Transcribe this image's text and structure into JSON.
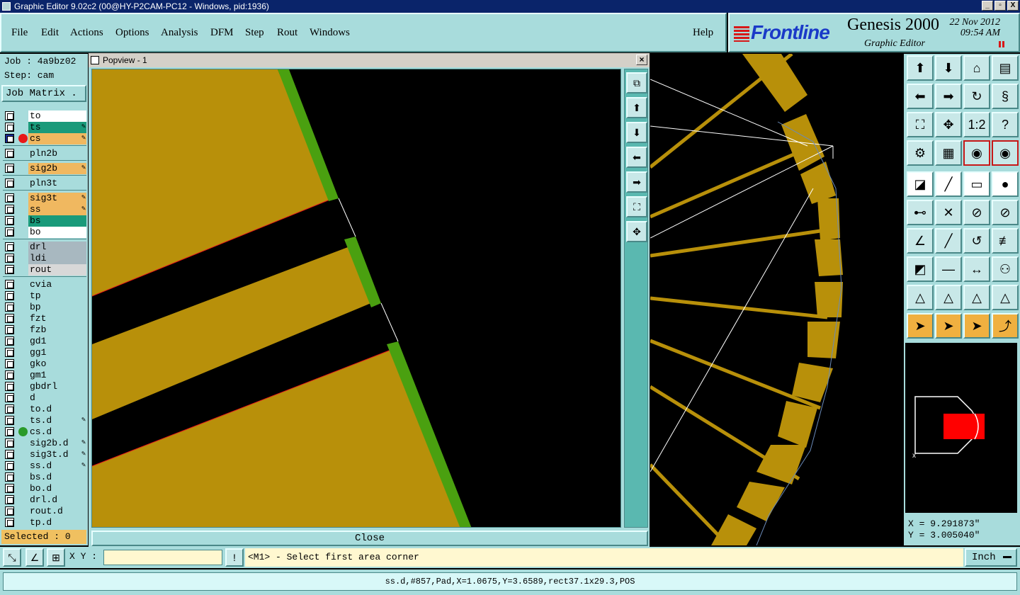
{
  "window": {
    "title": "Graphic Editor 9.02c2 (00@HY-P2CAM-PC12 - Windows, pid:1936)",
    "controls": [
      "_",
      "▫",
      "X"
    ]
  },
  "menu": {
    "items": [
      "File",
      "Edit",
      "Actions",
      "Options",
      "Analysis",
      "DFM",
      "Step",
      "Rout",
      "Windows"
    ],
    "help": "Help"
  },
  "brand": {
    "logo": "Frontline",
    "product": "Genesis 2000",
    "subtitle": "Graphic Editor",
    "date": "22 Nov 2012",
    "time": "09:54 AM"
  },
  "job": {
    "job_line": "Job : 4a9bz02",
    "step_line": "Step: cam",
    "matrix_button": "Job Matrix ."
  },
  "layers": [
    {
      "name": "to",
      "color": "#ffffff",
      "group": 0
    },
    {
      "name": "ts",
      "color": "#1a9a7a",
      "group": 0,
      "edit": true
    },
    {
      "name": "cs",
      "color": "#f0b860",
      "group": 0,
      "edit": true,
      "selected": true,
      "dot": "#e81818"
    },
    {
      "name": "pln2b",
      "color": "#a8dcdc",
      "group": 1
    },
    {
      "name": "sig2b",
      "color": "#f0b860",
      "group": 2,
      "edit": true
    },
    {
      "name": "pln3t",
      "color": "#a8dcdc",
      "group": 3
    },
    {
      "name": "sig3t",
      "color": "#f0b860",
      "group": 4,
      "edit": true
    },
    {
      "name": "ss",
      "color": "#f0b860",
      "group": 4,
      "edit": true
    },
    {
      "name": "bs",
      "color": "#1a9a7a",
      "group": 4
    },
    {
      "name": "bo",
      "color": "#ffffff",
      "group": 4
    },
    {
      "name": "drl",
      "color": "#a8b8c0",
      "group": 5
    },
    {
      "name": "ldi",
      "color": "#a8b8c0",
      "group": 5
    },
    {
      "name": "rout",
      "color": "#d8d8d8",
      "group": 5
    },
    {
      "name": "cvia",
      "color": "#a8dcdc",
      "group": 6
    },
    {
      "name": "tp",
      "color": "#a8dcdc",
      "group": 6
    },
    {
      "name": "bp",
      "color": "#a8dcdc",
      "group": 6
    },
    {
      "name": "fzt",
      "color": "#a8dcdc",
      "group": 6
    },
    {
      "name": "fzb",
      "color": "#a8dcdc",
      "group": 6
    },
    {
      "name": "gd1",
      "color": "#a8dcdc",
      "group": 6
    },
    {
      "name": "gg1",
      "color": "#a8dcdc",
      "group": 6
    },
    {
      "name": "gko",
      "color": "#a8dcdc",
      "group": 6
    },
    {
      "name": "gm1",
      "color": "#a8dcdc",
      "group": 6
    },
    {
      "name": "gbdrl",
      "color": "#a8dcdc",
      "group": 6
    },
    {
      "name": "d",
      "color": "#a8dcdc",
      "group": 6
    },
    {
      "name": "to.d",
      "color": "#a8dcdc",
      "group": 6
    },
    {
      "name": "ts.d",
      "color": "#a8dcdc",
      "group": 6,
      "edit": true
    },
    {
      "name": "cs.d",
      "color": "#a8dcdc",
      "group": 6,
      "dot": "#2a9a2a"
    },
    {
      "name": "sig2b.d",
      "color": "#a8dcdc",
      "group": 6,
      "edit": true
    },
    {
      "name": "sig3t.d",
      "color": "#a8dcdc",
      "group": 6,
      "edit": true
    },
    {
      "name": "ss.d",
      "color": "#a8dcdc",
      "group": 6,
      "edit": true
    },
    {
      "name": "bs.d",
      "color": "#a8dcdc",
      "group": 6
    },
    {
      "name": "bo.d",
      "color": "#a8dcdc",
      "group": 6
    },
    {
      "name": "drl.d",
      "color": "#a8dcdc",
      "group": 6
    },
    {
      "name": "rout.d",
      "color": "#a8dcdc",
      "group": 6
    },
    {
      "name": "tp.d",
      "color": "#a8dcdc",
      "group": 6
    }
  ],
  "selected_label": "Selected : 0",
  "popview": {
    "title": "Popview - 1",
    "close_label": "Close",
    "tools": [
      "zoom-window-icon",
      "pan-up-icon",
      "pan-down-icon",
      "pan-left-icon",
      "pan-right-icon",
      "zoom-fit-icon",
      "zoom-center-icon"
    ]
  },
  "toolbar": {
    "rows": [
      [
        "pan-up-icon",
        "pan-down-icon",
        "home-icon",
        "window-split-icon"
      ],
      [
        "pan-left-icon",
        "pan-right-icon",
        "redo-icon",
        "snap-icon"
      ],
      [
        "zoom-fit-icon",
        "zoom-center-icon",
        "scale-icon",
        "help-icon"
      ],
      [
        "settings-icon",
        "grid-icon",
        "layers-red-icon",
        "layers-red2-icon"
      ],
      [
        "select-pad-icon",
        "line-icon",
        "ruler-icon",
        "dot-icon"
      ],
      [
        "connect-icon",
        "intersect-icon",
        "add-pad-icon",
        "add-pad2-icon"
      ],
      [
        "angle-icon",
        "line-red-icon",
        "arc-icon",
        "align-icon"
      ],
      [
        "feature-icon",
        "dash-icon",
        "dimension-icon",
        "circles-icon"
      ],
      [
        "triangle-icon",
        "triangle2-icon",
        "triangle3-icon",
        "triangle4-icon"
      ],
      [
        "pointer-icon",
        "pointer-box-icon",
        "pointer-box2-icon",
        "route-icon"
      ]
    ],
    "scale_text": "1:2",
    "help_text": "?"
  },
  "coords": {
    "x": "X = 9.291873\"",
    "y": "Y = 3.005040\""
  },
  "cmdbar": {
    "xy_label": "X Y :",
    "xy_value": "",
    "prompt": "<M1> - Select first area corner",
    "units": "Inch"
  },
  "status": {
    "text": "ss.d,#857,Pad,X=1.0675,Y=3.6589,rect37.1x29.3,POS"
  },
  "colors": {
    "panel": "#a8dcdc",
    "copper": "#b8900a",
    "outline": "#4aa010",
    "accent_red": "#e81818",
    "highlight": "#f0b860"
  }
}
